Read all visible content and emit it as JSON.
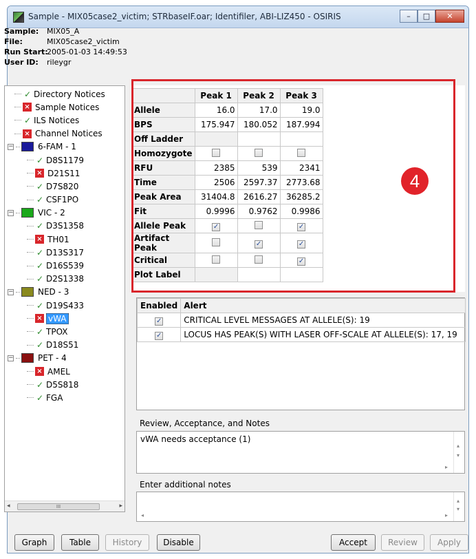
{
  "window": {
    "title": "Sample - MIX05case2_victim; STRbaseIF.oar; Identifiler, ABI-LIZ450 - OSIRIS"
  },
  "window_buttons": {
    "minimize": "–",
    "maximize": "□",
    "close": "✕"
  },
  "sample_info": [
    {
      "label": "Sample:",
      "value": "MIX05_A"
    },
    {
      "label": "File:",
      "value": "MIX05case2_victim"
    },
    {
      "label": "Run Start:",
      "value": "2005-01-03 14:49:53"
    },
    {
      "label": "User ID:",
      "value": "rileygr"
    }
  ],
  "tree": [
    {
      "label": "Directory Notices",
      "status": "ok",
      "level": 1
    },
    {
      "label": "Sample Notices",
      "status": "error",
      "level": 1
    },
    {
      "label": "ILS Notices",
      "status": "ok",
      "level": 1
    },
    {
      "label": "Channel Notices",
      "status": "error",
      "level": 1
    },
    {
      "label": "6-FAM - 1",
      "status": "channel",
      "color": "#1a1a9a",
      "level": 0
    },
    {
      "label": "D8S1179",
      "status": "ok",
      "level": 2
    },
    {
      "label": "D21S11",
      "status": "error",
      "level": 2
    },
    {
      "label": "D7S820",
      "status": "ok",
      "level": 2
    },
    {
      "label": "CSF1PO",
      "status": "ok",
      "level": 2
    },
    {
      "label": "VIC - 2",
      "status": "channel",
      "color": "#1aa81a",
      "level": 0
    },
    {
      "label": "D3S1358",
      "status": "ok",
      "level": 2
    },
    {
      "label": "TH01",
      "status": "error",
      "level": 2
    },
    {
      "label": "D13S317",
      "status": "ok",
      "level": 2
    },
    {
      "label": "D16S539",
      "status": "ok",
      "level": 2
    },
    {
      "label": "D2S1338",
      "status": "ok",
      "level": 2
    },
    {
      "label": "NED - 3",
      "status": "channel",
      "color": "#8a8a1e",
      "level": 0
    },
    {
      "label": "D19S433",
      "status": "ok",
      "level": 2
    },
    {
      "label": "vWA",
      "status": "error",
      "level": 2,
      "selected": true
    },
    {
      "label": "TPOX",
      "status": "ok",
      "level": 2
    },
    {
      "label": "D18S51",
      "status": "ok",
      "level": 2
    },
    {
      "label": "PET - 4",
      "status": "channel",
      "color": "#8a1010",
      "level": 0
    },
    {
      "label": "AMEL",
      "status": "error",
      "level": 2
    },
    {
      "label": "D5S818",
      "status": "ok",
      "level": 2
    },
    {
      "label": "FGA",
      "status": "ok",
      "level": 2
    }
  ],
  "tree_scroll": {
    "left": "◂",
    "right": "▸",
    "grip": "III"
  },
  "peaks": {
    "columns": [
      "Peak 1",
      "Peak 2",
      "Peak 3"
    ],
    "rows": [
      {
        "label": "Allele",
        "type": "text",
        "values": [
          "16.0",
          "17.0",
          "19.0"
        ]
      },
      {
        "label": "BPS",
        "type": "text",
        "values": [
          "175.947",
          "180.052",
          "187.994"
        ]
      },
      {
        "label": "Off Ladder",
        "type": "text",
        "values": [
          "",
          "",
          ""
        ]
      },
      {
        "label": "Homozygote",
        "type": "check",
        "values": [
          false,
          false,
          false
        ]
      },
      {
        "label": "RFU",
        "type": "text",
        "values": [
          "2385",
          "539",
          "2341"
        ]
      },
      {
        "label": "Time",
        "type": "text",
        "values": [
          "2506",
          "2597.37",
          "2773.68"
        ]
      },
      {
        "label": "Peak Area",
        "type": "text",
        "values": [
          "31404.8",
          "2616.27",
          "36285.2"
        ]
      },
      {
        "label": "Fit",
        "type": "text",
        "values": [
          "0.9996",
          "0.9762",
          "0.9986"
        ]
      },
      {
        "label": "Allele Peak",
        "type": "check",
        "values": [
          true,
          false,
          true
        ]
      },
      {
        "label": "Artifact Peak",
        "type": "check",
        "values": [
          false,
          true,
          true
        ]
      },
      {
        "label": "Critical",
        "type": "check",
        "values": [
          false,
          false,
          true
        ]
      },
      {
        "label": "Plot Label",
        "type": "text",
        "values": [
          "",
          "",
          ""
        ]
      }
    ]
  },
  "callout": {
    "number": "4"
  },
  "alerts": {
    "headers": [
      "Enabled",
      "Alert"
    ],
    "rows": [
      {
        "enabled": true,
        "text": "CRITICAL LEVEL MESSAGES AT ALLELE(S):  19"
      },
      {
        "enabled": true,
        "text": "LOCUS HAS PEAK(S) WITH LASER OFF-SCALE AT ALLELE(S):  17, 19"
      }
    ]
  },
  "review": {
    "label": "Review, Acceptance, and Notes",
    "text": "vWA needs acceptance (1)"
  },
  "notes": {
    "label": "Enter additional notes",
    "value": ""
  },
  "scroll_arrows": {
    "up": "▴",
    "down": "▾",
    "left": "◂",
    "right": "▸"
  },
  "buttons": {
    "graph": "Graph",
    "table": "Table",
    "history": "History",
    "disable": "Disable",
    "accept": "Accept",
    "review": "Review",
    "apply": "Apply"
  }
}
